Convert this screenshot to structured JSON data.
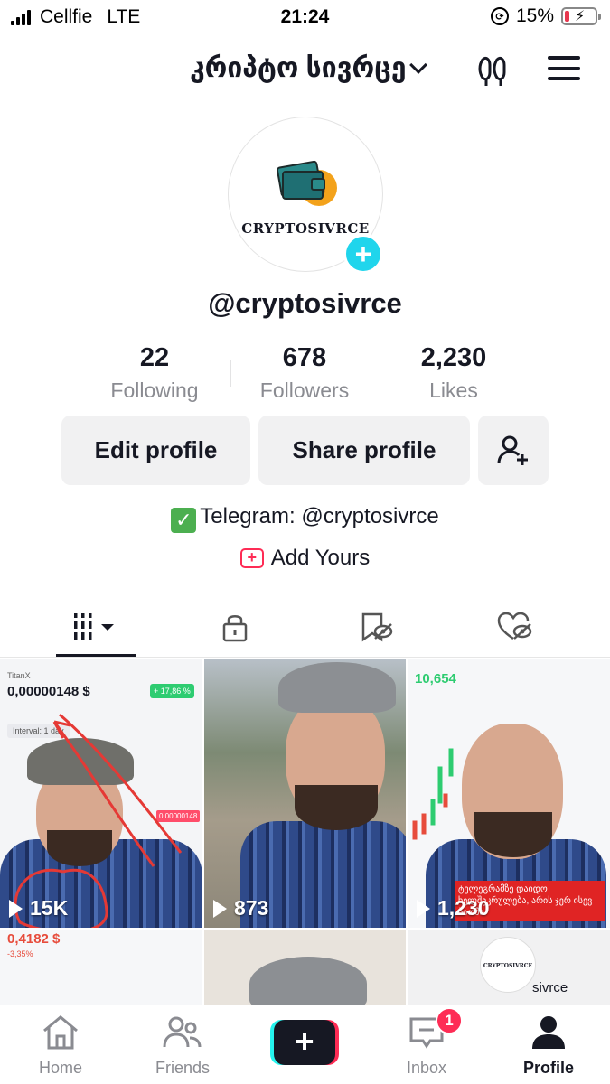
{
  "status_bar": {
    "carrier": "Cellfie",
    "network": "LTE",
    "time": "21:24",
    "battery_percent": "15%",
    "battery_level": 0.15,
    "battery_color": "#e8384f"
  },
  "header": {
    "account_name": "კრიპტო სივრცე",
    "icons": [
      "chevron-down-icon",
      "glasses-icon",
      "menu-icon"
    ]
  },
  "profile": {
    "avatar_logo_text": "CRYPTOSIVRCE",
    "username": "@cryptosivrce",
    "stats": [
      {
        "value": "22",
        "label": "Following"
      },
      {
        "value": "678",
        "label": "Followers"
      },
      {
        "value": "2,230",
        "label": "Likes"
      }
    ],
    "buttons": {
      "edit": "Edit profile",
      "share": "Share profile"
    },
    "bio": "Telegram: @cryptosivrce",
    "add_yours": "Add Yours"
  },
  "tabs": [
    {
      "icon": "videos-grid-icon",
      "active": true
    },
    {
      "icon": "private-lock-icon",
      "active": false
    },
    {
      "icon": "favorites-hidden-icon",
      "active": false
    },
    {
      "icon": "liked-hidden-icon",
      "active": false
    }
  ],
  "videos": [
    {
      "plays": "15K",
      "overlay_price": "0,00000148 $",
      "overlay_ticker": "TitanX",
      "overlay_change": "+ 17,86 %",
      "overlay_interval": "Interval: 1 day"
    },
    {
      "plays": "873"
    },
    {
      "plays": "1,230",
      "overlay_price": "10,654",
      "overlay_caption": "ტელეგრამზე დაიდო ხელშეკრულება, არის ჯერ ისევ ბიომი."
    },
    {
      "overlay_price": "0,4182 $",
      "overlay_change": "-3,35%"
    },
    {},
    {
      "overlay_logo": "CRYPTOSIVRCE",
      "overlay_text": "sivrce"
    }
  ],
  "bottom_nav": [
    {
      "label": "Home",
      "icon": "home-icon"
    },
    {
      "label": "Friends",
      "icon": "friends-icon"
    },
    {
      "label": "",
      "icon": "create-plus-icon"
    },
    {
      "label": "Inbox",
      "icon": "inbox-icon",
      "badge": "1"
    },
    {
      "label": "Profile",
      "icon": "profile-icon",
      "active": true
    }
  ],
  "colors": {
    "accent_pink": "#fe2c55",
    "accent_cyan": "#20d5ec",
    "text_primary": "#161823",
    "text_secondary": "#8a8b91"
  }
}
